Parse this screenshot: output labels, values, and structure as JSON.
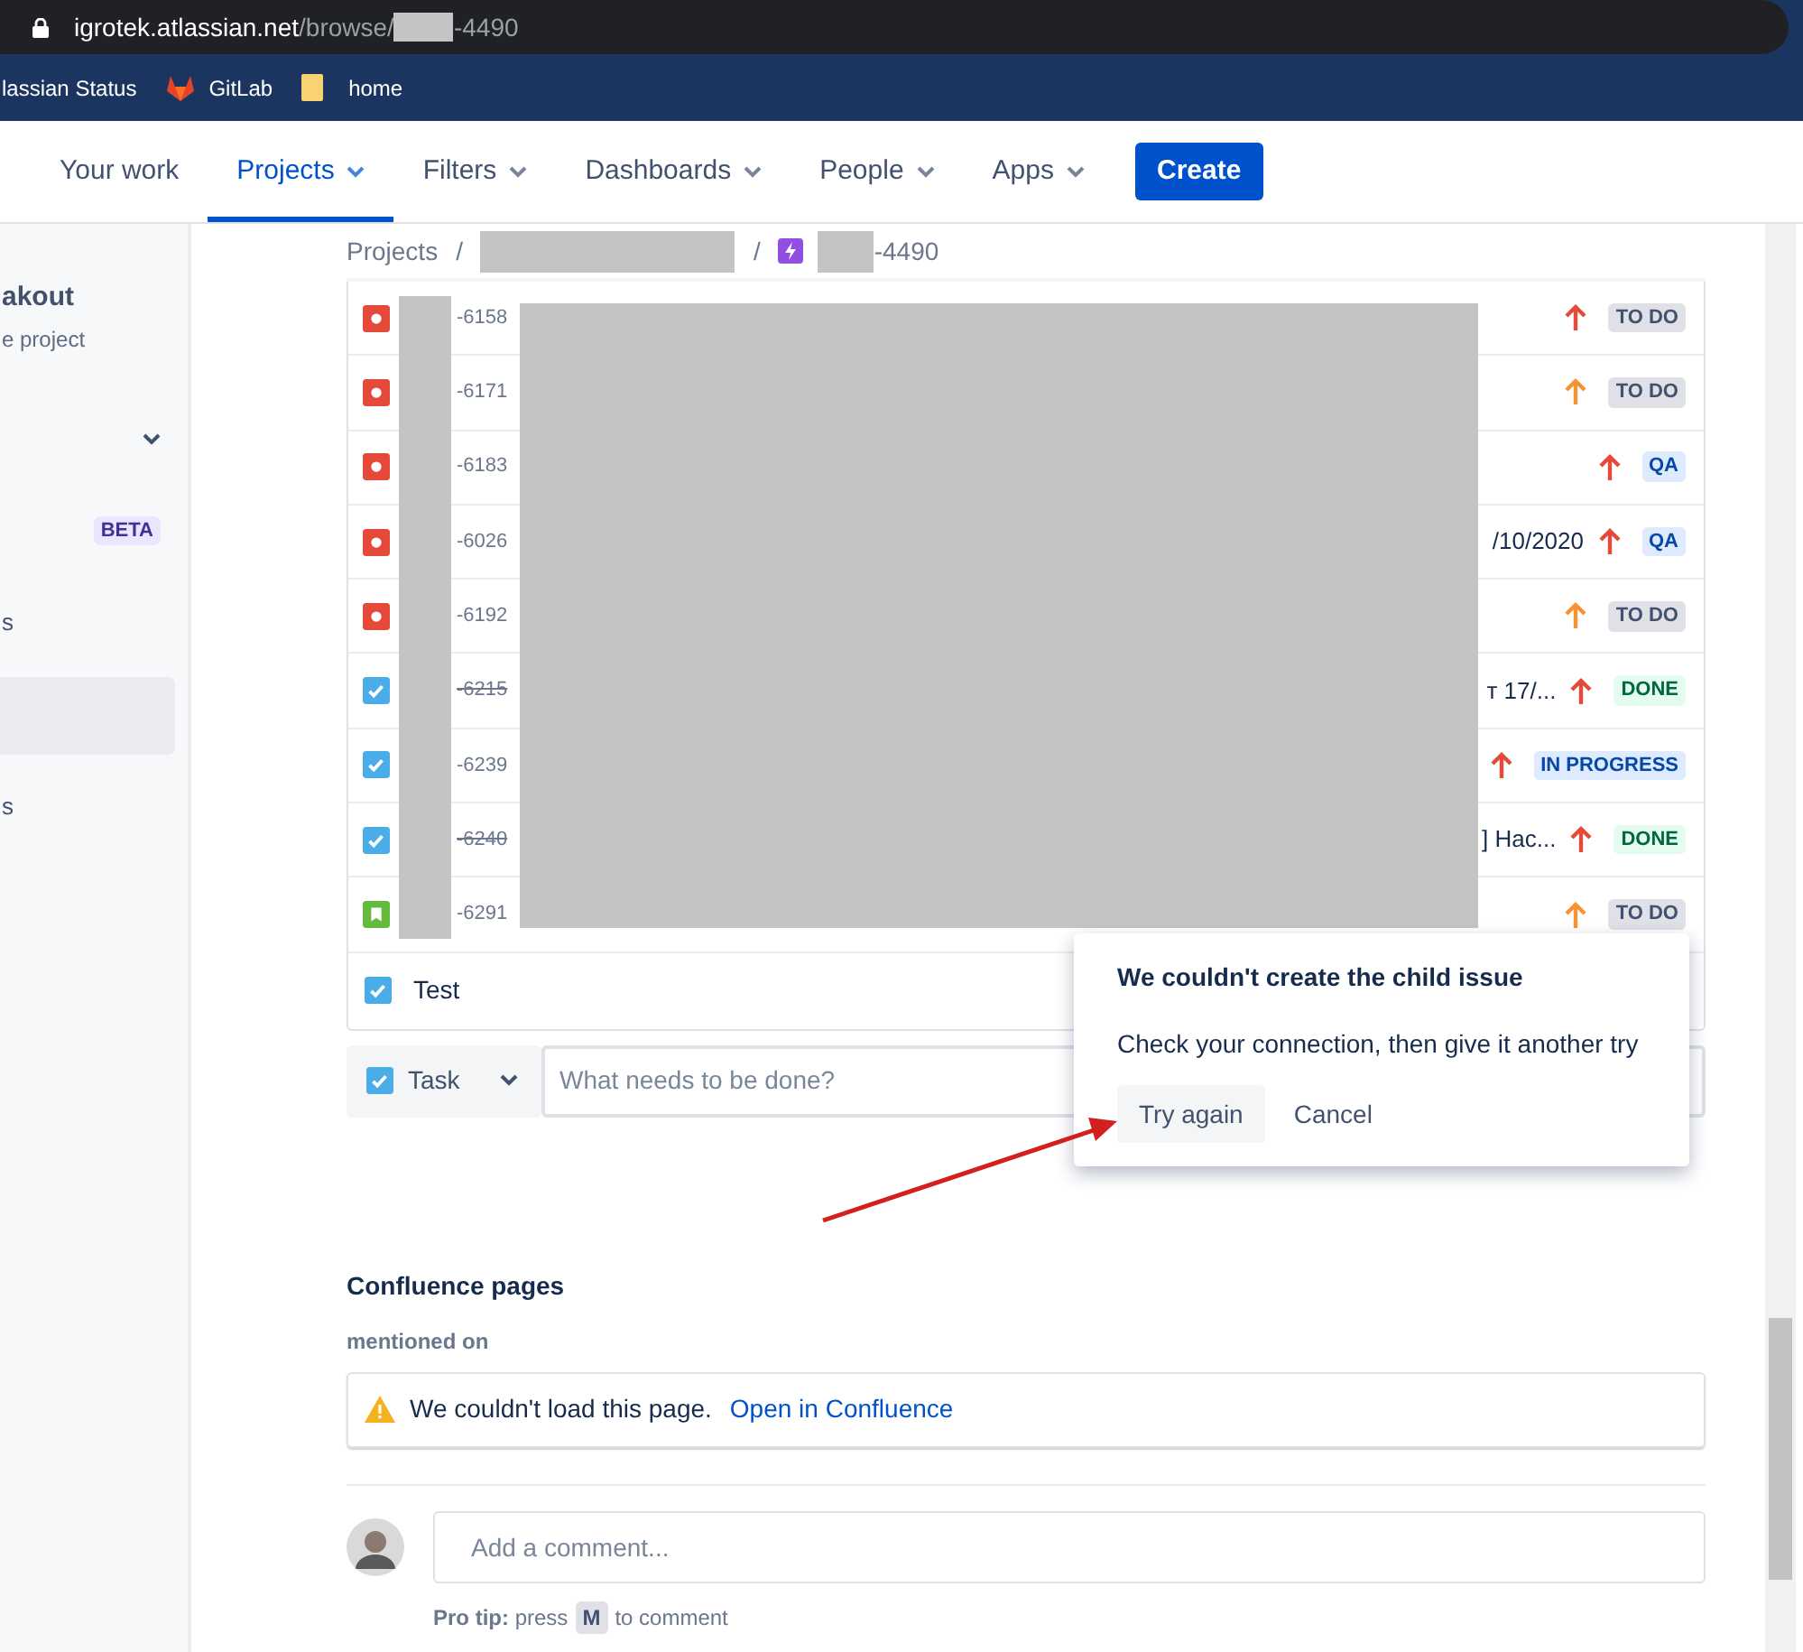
{
  "address_bar": {
    "host": "igrotek.atlassian.net",
    "path": "/browse/",
    "key_suffix": "-4490"
  },
  "bookmarks": [
    {
      "label": "lassian Status",
      "kind": "plain"
    },
    {
      "label": "GitLab",
      "kind": "gitlab"
    },
    {
      "label": "home",
      "kind": "folder"
    }
  ],
  "nav": {
    "items": [
      {
        "label": "Your work",
        "selected": false,
        "dropdown": false
      },
      {
        "label": "Projects",
        "selected": true,
        "dropdown": true
      },
      {
        "label": "Filters",
        "selected": false,
        "dropdown": true
      },
      {
        "label": "Dashboards",
        "selected": false,
        "dropdown": true
      },
      {
        "label": "People",
        "selected": false,
        "dropdown": true
      },
      {
        "label": "Apps",
        "selected": false,
        "dropdown": true
      }
    ],
    "create_button": "Create"
  },
  "sidebar": {
    "project_name": "akout",
    "project_type": "e project",
    "items": [
      {
        "kind": "dropdown",
        "selected": false
      },
      {
        "kind": "badge",
        "label": "BETA",
        "selected": false
      },
      {
        "kind": "text",
        "label": "s",
        "selected": false
      },
      {
        "kind": "text",
        "selected": true
      },
      {
        "kind": "text",
        "label": "s",
        "selected": false
      }
    ]
  },
  "breadcrumb": {
    "root": "Projects",
    "separator": "/",
    "issue_key_suffix": "-4490"
  },
  "child_issues": [
    {
      "kind": "bug",
      "key": "-6158",
      "priority": {
        "color": "#e5493a"
      },
      "status": {
        "label": "TO DO",
        "color": "#dfe1e6"
      },
      "done": false
    },
    {
      "kind": "bug",
      "key": "-6171",
      "priority": {
        "color": "#f79232"
      },
      "status": {
        "label": "TO DO",
        "color": "#dfe1e6"
      },
      "done": false
    },
    {
      "kind": "bug",
      "key": "-6183",
      "priority": {
        "color": "#e5493a"
      },
      "status": {
        "label": "QA",
        "color": "#deebff"
      },
      "done": false
    },
    {
      "kind": "bug",
      "key": "-6026",
      "summary": "/10/2020",
      "priority": {
        "color": "#e5493a"
      },
      "status": {
        "label": "QA",
        "color": "#deebff"
      },
      "done": false
    },
    {
      "kind": "bug",
      "key": "-6192",
      "priority": {
        "color": "#f79232"
      },
      "status": {
        "label": "TO DO",
        "color": "#dfe1e6"
      },
      "done": false
    },
    {
      "kind": "task",
      "key": "-6215",
      "summary": "т 17/...",
      "priority": {
        "color": "#e5493a"
      },
      "status": {
        "label": "DONE",
        "color": "#e3fcef"
      },
      "done": true
    },
    {
      "kind": "task",
      "key": "-6239",
      "priority": {
        "color": "#e5493a"
      },
      "status": {
        "label": "IN PROGRESS",
        "color": "#deebff"
      },
      "done": false
    },
    {
      "kind": "task",
      "key": "-6240",
      "summary": "] Нас...",
      "priority": {
        "color": "#e5493a"
      },
      "status": {
        "label": "DONE",
        "color": "#e3fcef"
      },
      "done": true
    },
    {
      "kind": "story",
      "key": "-6291",
      "priority": {
        "color": "#f79232"
      },
      "status": {
        "label": "TO DO",
        "color": "#dfe1e6"
      },
      "done": false
    }
  ],
  "pending_child": {
    "kind": "task",
    "label": "Test"
  },
  "create_row": {
    "kind": "task",
    "type_label": "Task",
    "placeholder": "What needs to be done?"
  },
  "error_popover": {
    "title": "We couldn't create the child issue",
    "message": "Check your connection, then give it another try",
    "buttons": [
      {
        "label": "Try again",
        "kind": "primary"
      },
      {
        "label": "Cancel",
        "kind": "subtle"
      }
    ]
  },
  "confluence": {
    "heading": "Confluence pages",
    "subheading": "mentioned on",
    "warning": "We couldn't load this page.",
    "link": "Open in Confluence"
  },
  "comment": {
    "placeholder": "Add a comment...",
    "tip": "**Pro tip:** press",
    "key": "M",
    "tip_after": "to comment"
  }
}
